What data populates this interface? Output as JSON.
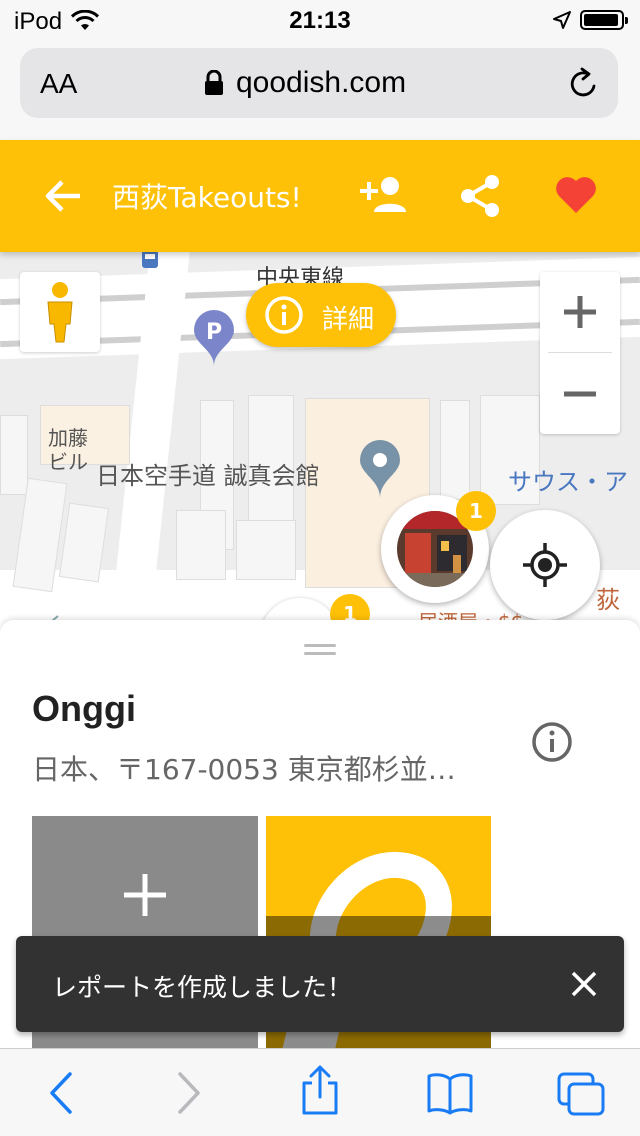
{
  "status_bar": {
    "carrier": "iPod",
    "time": "21:13"
  },
  "browser": {
    "text_size_label": "AA",
    "domain": "qoodish.com"
  },
  "header": {
    "title": "西荻Takeouts!"
  },
  "map": {
    "detail_button_label": "詳細",
    "labels": {
      "rail": "中央東線",
      "building1_line1": "加藤",
      "building1_line2": "ビル",
      "dojo": "日本空手道 誠真会館",
      "saus": "サウス・ア",
      "ogikubo": "荻窪",
      "izakaya": "居酒屋・$$"
    },
    "marker_count": "1",
    "marker2_count": "1"
  },
  "spot": {
    "name": "Onggi",
    "address": "日本、〒167-0053 東京都杉並…"
  },
  "snackbar": {
    "message": "レポートを作成しました！"
  },
  "colors": {
    "primary": "#ffc107",
    "heart": "#f44336",
    "safari_blue": "#1a7cf5"
  }
}
